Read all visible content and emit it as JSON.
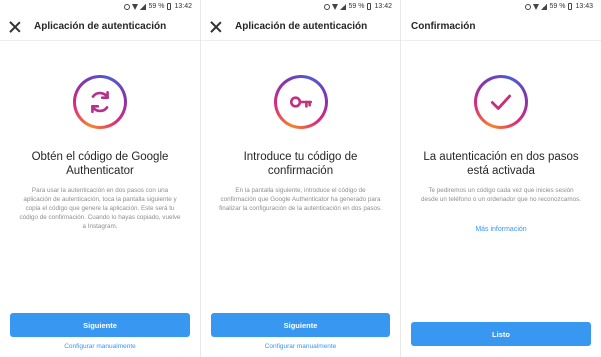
{
  "screens": [
    {
      "status": {
        "battery": "59 %",
        "time": "13:42"
      },
      "title": "Aplicación de autenticación",
      "icon": "sync-icon",
      "heading": "Obtén el código de Google Authenticator",
      "description": "Para usar la autenticación en dos pasos con una aplicación de autenticación, toca la pantalla siguiente y copia el código que genere la aplicación. Este será tu código de confirmación. Cuando lo hayas copiado, vuelve a Instagram.",
      "primary_button": "Siguiente",
      "secondary_link": "Configurar manualmente"
    },
    {
      "status": {
        "battery": "59 %",
        "time": "13:42"
      },
      "title": "Aplicación de autenticación",
      "icon": "key-icon",
      "heading": "Introduce tu código de confirmación",
      "description": "En la pantalla siguiente, introduce el código de confirmación que Google Authenticator ha generado para finalizar la configuración de la autenticación en dos pasos.",
      "primary_button": "Siguiente",
      "secondary_link": "Configurar manualmente"
    },
    {
      "status": {
        "battery": "59 %",
        "time": "13:43"
      },
      "title": "Confirmación",
      "icon": "checkmark-icon",
      "heading": "La autenticación en dos pasos está activada",
      "description": "Te pediremos un código cada vez que inicies sesión desde un teléfono o un ordenador que no reconozcamos.",
      "link": "Más información",
      "primary_button": "Listo"
    }
  ],
  "colors": {
    "accent": "#3897f0",
    "gradient": [
      "#f58529",
      "#dd2a7b",
      "#8134af",
      "#515bd4"
    ],
    "text_secondary": "#8e8e8e"
  }
}
